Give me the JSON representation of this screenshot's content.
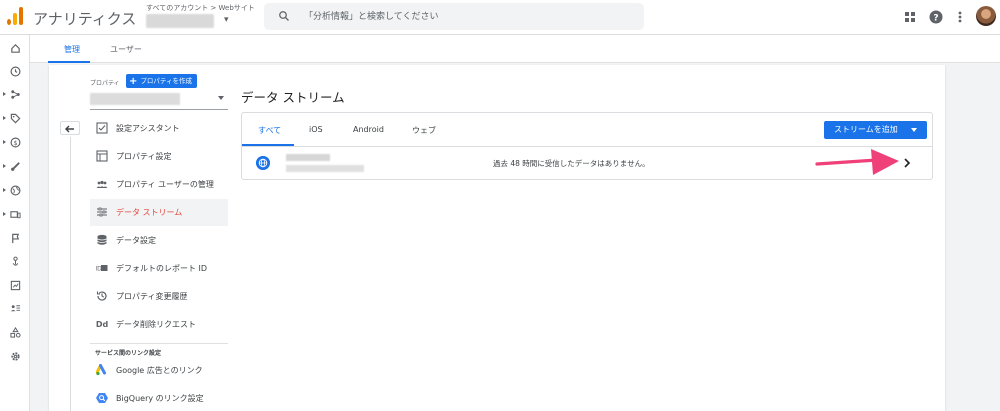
{
  "header": {
    "app_title": "アナリティクス",
    "breadcrumb": "すべてのアカウント > Webサイト",
    "search_placeholder": "「分析情報」と検索してください",
    "icons": [
      "apps-grid-icon",
      "help-icon",
      "more-vert-icon"
    ]
  },
  "tabs": [
    {
      "label": "管理",
      "active": true
    },
    {
      "label": "ユーザー",
      "active": false
    }
  ],
  "property": {
    "label": "プロパティ",
    "create_button": "プロパティを作成"
  },
  "menu": [
    {
      "label": "設定アシスタント",
      "icon": "checklist-icon"
    },
    {
      "label": "プロパティ設定",
      "icon": "property-settings-icon"
    },
    {
      "label": "プロパティ ユーザーの管理",
      "icon": "users-icon"
    },
    {
      "label": "データ ストリーム",
      "icon": "data-stream-icon",
      "selected": true
    },
    {
      "label": "データ設定",
      "icon": "database-icon"
    },
    {
      "label": "デフォルトのレポート ID",
      "icon": "report-id-icon"
    },
    {
      "label": "プロパティ変更履歴",
      "icon": "history-icon"
    },
    {
      "label": "データ削除リクエスト",
      "icon": "data-delete-icon"
    }
  ],
  "section_heading": "サービス間のリンク設定",
  "links": [
    {
      "label": "Google 広告とのリンク",
      "icon": "google-ads-icon"
    },
    {
      "label": "BigQuery のリンク設定",
      "icon": "bigquery-icon"
    }
  ],
  "main": {
    "title": "データ ストリーム",
    "stream_tabs": [
      {
        "label": "すべて",
        "active": true
      },
      {
        "label": "iOS"
      },
      {
        "label": "Android"
      },
      {
        "label": "ウェブ"
      }
    ],
    "add_stream_button": "ストリームを追加",
    "stream": {
      "status": "過去 48 時間に受信したデータはありません。",
      "icon": "globe-icon"
    }
  },
  "colors": {
    "accent": "#1a73e8",
    "selected_text": "#e8453c",
    "annotation_arrow": "#f0407a"
  }
}
